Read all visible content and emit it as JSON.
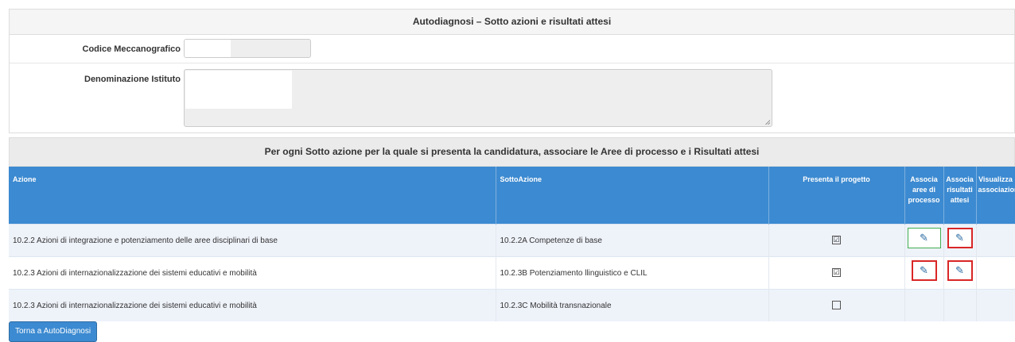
{
  "header": {
    "title": "Autodiagnosi – Sotto azioni e risultati attesi"
  },
  "form": {
    "codice_label": "Codice Meccanografico",
    "codice_value": "",
    "denominazione_label": "Denominazione Istituto",
    "denominazione_value": ""
  },
  "section": {
    "title": "Per ogni Sotto azione per la quale si presenta la candidatura, associare le Aree di processo e i Risultati attesi"
  },
  "table": {
    "columns": [
      "Azione",
      "SottoAzione",
      "Presenta il progetto",
      "Associa aree di processo",
      "Associa risultati attesi",
      "Visualizza associazioni"
    ],
    "rows": [
      {
        "azione": "10.2.2 Azioni di integrazione e potenziamento delle aree disciplinari di base",
        "sottoazione": "10.2.2A Competenze di base",
        "presenta": true,
        "check_glyph": "☑",
        "aree_edit": true,
        "risultati_edit": true
      },
      {
        "azione": "10.2.3 Azioni di internazionalizzazione dei sistemi educativi e mobilità",
        "sottoazione": "10.2.3B Potenziamento llinguistico e CLIL",
        "presenta": true,
        "check_glyph": "☑",
        "aree_edit": true,
        "risultati_edit": true
      },
      {
        "azione": "10.2.3 Azioni di internazionalizzazione dei sistemi educativi e mobilità",
        "sottoazione": "10.2.3C Mobilità transnazionale",
        "presenta": false,
        "check_glyph": "",
        "aree_edit": false,
        "risultati_edit": false
      }
    ]
  },
  "icons": {
    "edit": "pencil-icon"
  },
  "colors": {
    "header_blue": "#3c8ad1",
    "edit_border": "#d92626",
    "edit_active_border": "#3fae4f"
  },
  "footer": {
    "back_label": "Torna a AutoDiagnosi"
  }
}
